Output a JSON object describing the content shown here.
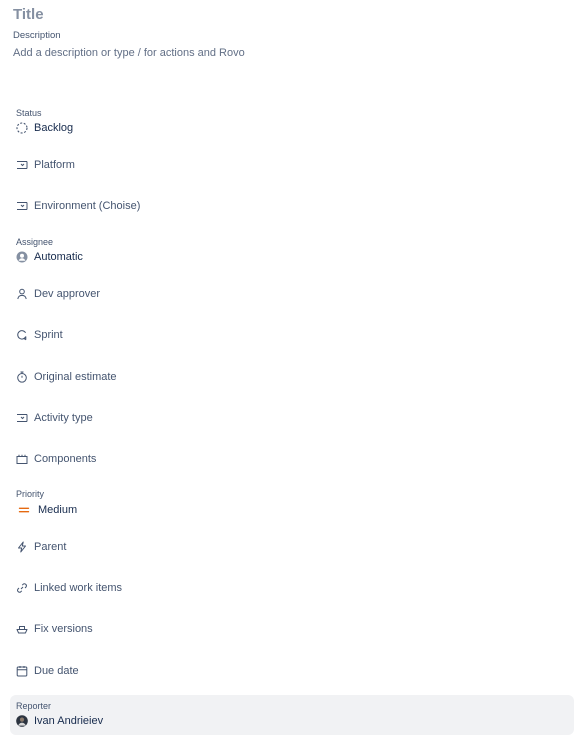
{
  "header": {
    "title_placeholder": "Title",
    "description_label": "Description",
    "description_placeholder": "Add a description or type / for actions and Rovo"
  },
  "fields": {
    "status": {
      "label": "Status",
      "value": "Backlog",
      "icon": "backlog-dashed-circle-icon"
    },
    "platform": {
      "label": "Platform",
      "icon": "select-field-icon"
    },
    "environment": {
      "label": "Environment (Choise)",
      "icon": "select-field-icon"
    },
    "assignee": {
      "label": "Assignee",
      "value": "Automatic",
      "icon": "user-avatar-icon"
    },
    "dev_approver": {
      "label": "Dev approver",
      "icon": "person-icon"
    },
    "sprint": {
      "label": "Sprint",
      "icon": "sprint-icon"
    },
    "original_estimate": {
      "label": "Original estimate",
      "icon": "stopwatch-icon"
    },
    "activity_type": {
      "label": "Activity type",
      "icon": "select-field-icon"
    },
    "components": {
      "label": "Components",
      "icon": "components-icon"
    },
    "priority": {
      "label": "Priority",
      "value": "Medium",
      "icon": "priority-medium-icon",
      "color": "#e56910"
    },
    "parent": {
      "label": "Parent",
      "icon": "lightning-icon"
    },
    "linked_work_items": {
      "label": "Linked work items",
      "icon": "link-icon"
    },
    "fix_versions": {
      "label": "Fix versions",
      "icon": "ship-icon"
    },
    "due_date": {
      "label": "Due date",
      "icon": "calendar-icon"
    },
    "reporter": {
      "label": "Reporter",
      "value": "Ivan Andrieiev",
      "icon": "user-photo-avatar"
    }
  },
  "colors": {
    "icon_gray": "#44546f",
    "muted_text": "#626f86",
    "reporter_bg": "#f1f2f4"
  }
}
